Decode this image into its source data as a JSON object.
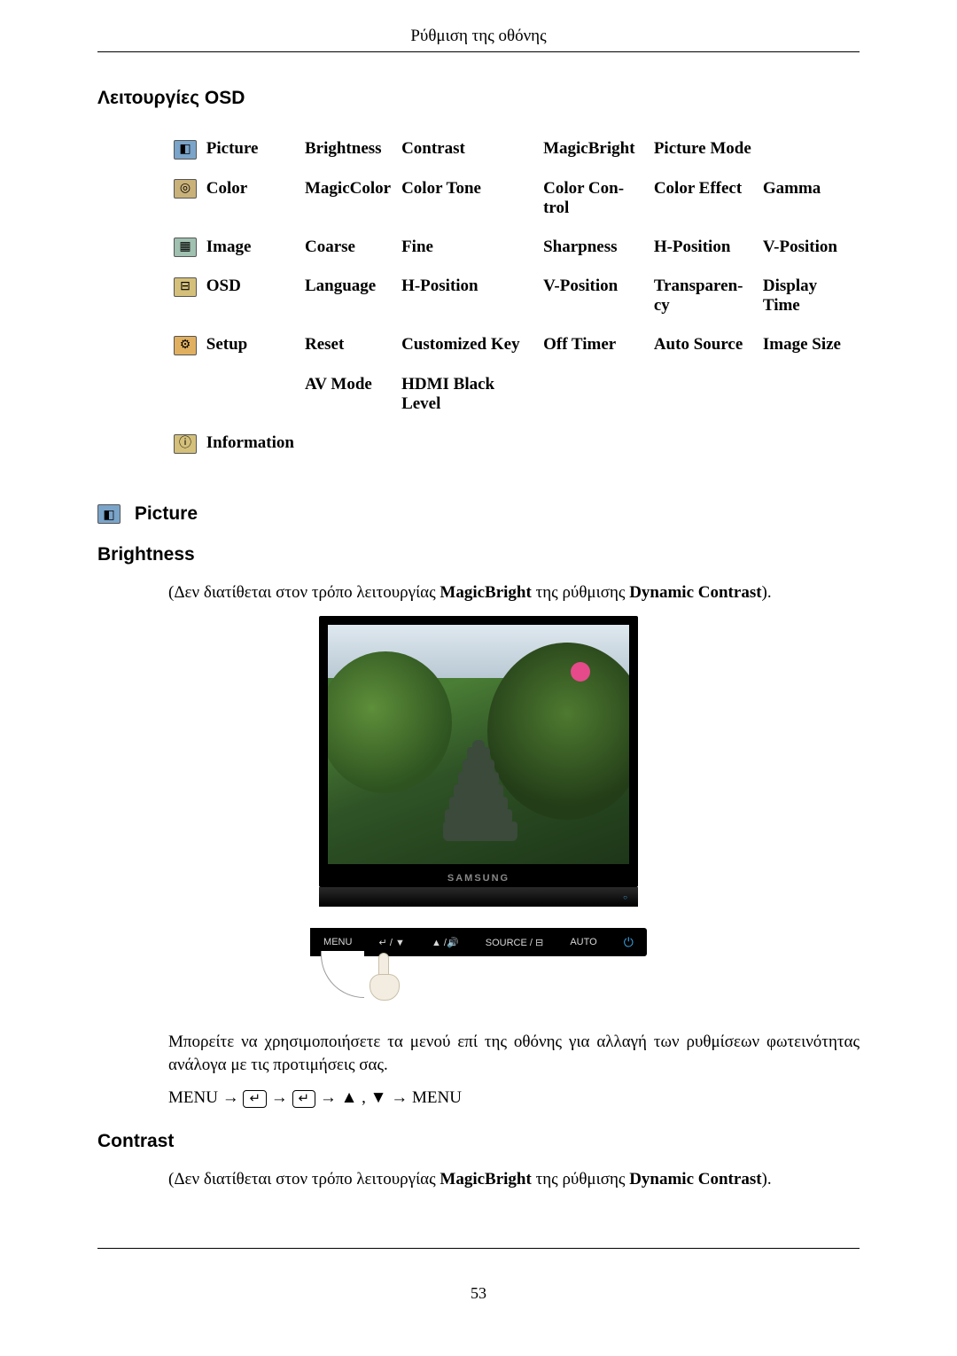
{
  "header": {
    "title": "Ρύθμιση της οθόνης"
  },
  "sections": {
    "osd_title": "Λειτουργίες OSD",
    "picture_section": "Picture",
    "brightness_heading": "Brightness",
    "contrast_heading": "Contrast"
  },
  "osd_table": {
    "rows": [
      {
        "cat": "Picture",
        "icon": "picture",
        "c": [
          "Brightness",
          "Contrast",
          "MagicBright",
          "Picture Mode",
          ""
        ]
      },
      {
        "cat": "Color",
        "icon": "color",
        "c": [
          "MagicColor",
          "Color Tone",
          "Color Con­trol",
          "Color Effect",
          "Gamma"
        ]
      },
      {
        "cat": "Image",
        "icon": "image",
        "c": [
          "Coarse",
          "Fine",
          "Sharpness",
          "H-Position",
          "V-Position"
        ]
      },
      {
        "cat": "OSD",
        "icon": "osd",
        "c": [
          "Language",
          "H-Position",
          "V-Position",
          "Transparen­cy",
          "Display Time"
        ]
      },
      {
        "cat": "Setup",
        "icon": "setup",
        "c": [
          "Reset",
          "Customized Key",
          "Off Timer",
          "Auto Source",
          "Image Size"
        ]
      },
      {
        "cat": "",
        "icon": "",
        "c": [
          "AV Mode",
          "HDMI Black Level",
          "",
          "",
          ""
        ]
      },
      {
        "cat": "Information",
        "icon": "info",
        "c": [
          "",
          "",
          "",
          "",
          ""
        ]
      }
    ]
  },
  "brightness": {
    "note_prefix": "(Δεν διατίθεται στον τρόπο λειτουργίας ",
    "note_bold1": "MagicBright",
    "note_mid": " της ρύθμισης ",
    "note_bold2": "Dynamic Contrast",
    "note_suffix": ").",
    "brand": "SAMSUNG",
    "controls": {
      "menu": "MENU",
      "enter_down": "/ ▼",
      "up_vol": "▲ /",
      "source": "SOURCE /",
      "auto": "AUTO"
    },
    "body": "Μπορείτε να χρησιμοποιήσετε τα μενού επί της οθόνης για αλλαγή των ρυθμίσεων φωτεινότητας ανάλογα με τις προτιμήσεις σας.",
    "path_menu": "MENU",
    "path_enter": "↵",
    "path_arrows": " , ",
    "path_up": "▲",
    "path_down": "▼"
  },
  "contrast": {
    "note_prefix": "(Δεν διατίθεται στον τρόπο λειτουργίας ",
    "note_bold1": "MagicBright",
    "note_mid": " της ρύθμισης ",
    "note_bold2": "Dynamic Contrast",
    "note_suffix": ")."
  },
  "icon_glyphs": {
    "picture": "◧",
    "color": "◎",
    "image": "▦",
    "osd": "⊟",
    "setup": "⚙",
    "info": "ⓘ",
    "enter": "↵",
    "vol": "🔊",
    "source_box": "⊟",
    "power": "⏻"
  },
  "footer": {
    "page": "53"
  }
}
